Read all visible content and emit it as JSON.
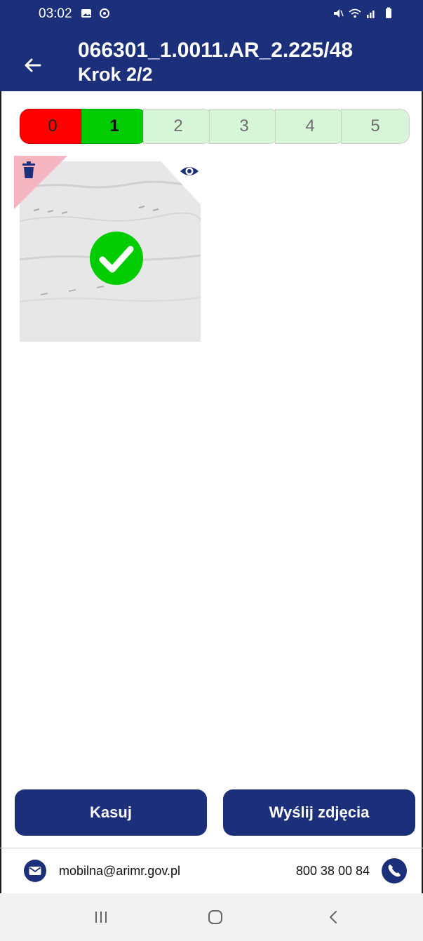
{
  "status_bar": {
    "time": "03:02"
  },
  "header": {
    "title": "066301_1.0011.AR_2.225/48",
    "subtitle": "Krok 2/2"
  },
  "segments": [
    "0",
    "1",
    "2",
    "3",
    "4",
    "5"
  ],
  "actions": {
    "delete_label": "Kasuj",
    "send_label": "Wyślij zdjęcia"
  },
  "footer": {
    "email": "mobilna@arimr.gov.pl",
    "phone": "800 38 00 84"
  },
  "colors": {
    "header": "#1c2f7a",
    "segment_red": "#ff0000",
    "segment_green": "#00cc00",
    "segment_light": "#d7f5d7",
    "check": "#00cc00"
  }
}
